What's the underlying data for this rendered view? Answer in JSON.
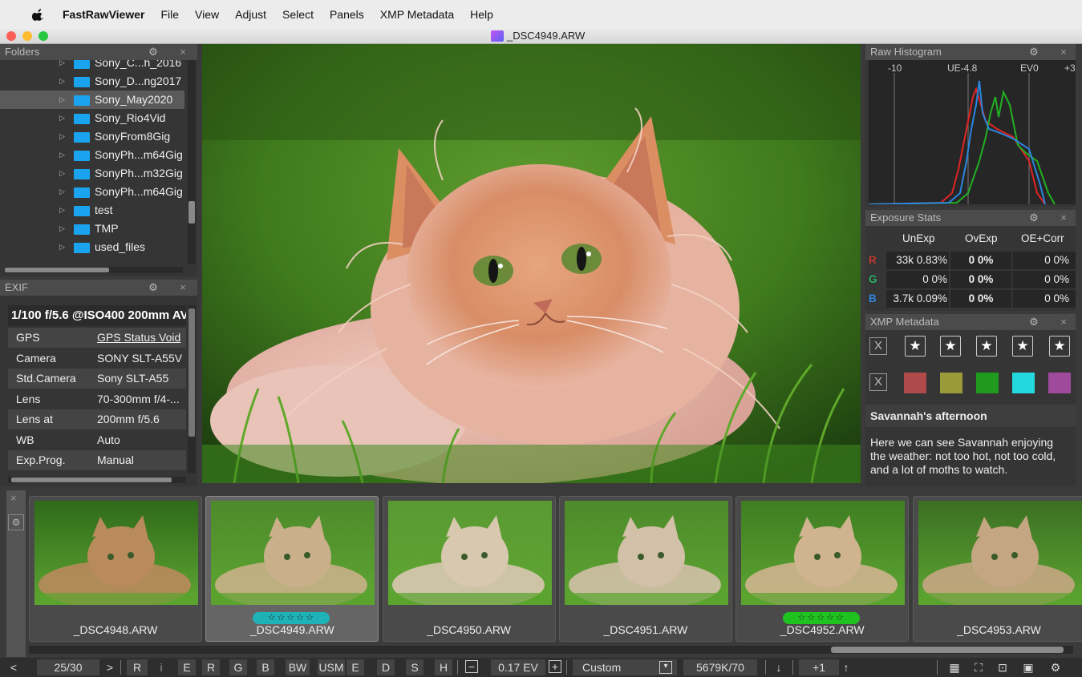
{
  "menubar": {
    "app": "FastRawViewer",
    "items": [
      "File",
      "View",
      "Adjust",
      "Select",
      "Panels",
      "XMP Metadata",
      "Help"
    ]
  },
  "window": {
    "title": "_DSC4949.ARW"
  },
  "folders": {
    "title": "Folders",
    "items": [
      {
        "label": "Sony_C...h_2016",
        "selected": false
      },
      {
        "label": "Sony_D...ng2017",
        "selected": false
      },
      {
        "label": "Sony_May2020",
        "selected": true
      },
      {
        "label": "Sony_Rio4Vid",
        "selected": false
      },
      {
        "label": "SonyFrom8Gig",
        "selected": false
      },
      {
        "label": "SonyPh...m64Gig",
        "selected": false
      },
      {
        "label": "SonyPh...m32Gig",
        "selected": false
      },
      {
        "label": "SonyPh...m64Gig",
        "selected": false
      },
      {
        "label": "test",
        "selected": false
      },
      {
        "label": "TMP",
        "selected": false
      },
      {
        "label": "used_files",
        "selected": false
      }
    ]
  },
  "exif": {
    "title": "EXIF",
    "summary": "1/100 f/5.6 @ISO400 200mm AV",
    "rows": [
      {
        "key": "GPS",
        "value": "GPS Status Void"
      },
      {
        "key": "Camera",
        "value": "SONY SLT-A55V"
      },
      {
        "key": "Std.Camera",
        "value": "Sony SLT-A55"
      },
      {
        "key": "Lens",
        "value": "70-300mm f/4-..."
      },
      {
        "key": "Lens at",
        "value": "200mm f/5.6"
      },
      {
        "key": "WB",
        "value": "Auto"
      },
      {
        "key": "Exp.Prog.",
        "value": "Manual"
      }
    ]
  },
  "histogram": {
    "title": "Raw Histogram",
    "labels": [
      "-10",
      "UE-4.8",
      "EV0",
      "+3"
    ]
  },
  "exposure": {
    "title": "Exposure Stats",
    "headers": [
      "UnExp",
      "OvExp",
      "OE+Corr"
    ],
    "rows": [
      {
        "ch": "R",
        "color": "#c0392b",
        "unexp": "33k 0.83%",
        "ovexp": "0 0%",
        "oecorr": "0 0%"
      },
      {
        "ch": "G",
        "color": "#27ae60",
        "unexp": "0 0%",
        "ovexp": "0 0%",
        "oecorr": "0 0%"
      },
      {
        "ch": "B",
        "color": "#2e86de",
        "unexp": "3.7k 0.09%",
        "ovexp": "0 0%",
        "oecorr": "0 0%"
      }
    ]
  },
  "xmp": {
    "title": "XMP Metadata",
    "reject_label": "X",
    "stars": [
      "★",
      "★",
      "★",
      "★",
      "★"
    ],
    "color_labels": [
      "#b04a4a",
      "#9a9a3a",
      "#1f9a1f",
      "#24d8e0",
      "#a04a9c"
    ],
    "headline": "Savannah's afternoon",
    "description": "Here we can see Savannah enjoying the weather: not too hot, not too cold, and a lot of moths to watch."
  },
  "filmstrip": {
    "thumbs": [
      {
        "name": "_DSC4948.ARW",
        "selected": false,
        "rating": ""
      },
      {
        "name": "_DSC4949.ARW",
        "selected": true,
        "rating": "☆☆☆☆☆",
        "rating_color": "#1fb3b8"
      },
      {
        "name": "_DSC4950.ARW",
        "selected": false,
        "rating": ""
      },
      {
        "name": "_DSC4951.ARW",
        "selected": false,
        "rating": ""
      },
      {
        "name": "_DSC4952.ARW",
        "selected": false,
        "rating": "☆☆☆☆☆",
        "rating_color": "#1fc21f"
      },
      {
        "name": "_DSC4953.ARW",
        "selected": false,
        "rating": ""
      }
    ]
  },
  "toolbar": {
    "prev": "<",
    "counter": "25/30",
    "next": ">",
    "r": "R",
    "i": "i",
    "e": "E",
    "ch_r": "R",
    "ch_g": "G",
    "ch_b": "B",
    "bw": "BW",
    "usm": "USM",
    "usm_e": "E",
    "d": "D",
    "s": "S",
    "h": "H",
    "minus": "−",
    "ev": "0.17 EV",
    "plus": "+",
    "profile": "Custom",
    "wb": "5679K/70",
    "down": "↓",
    "plus1": "+1",
    "up": "↑"
  }
}
